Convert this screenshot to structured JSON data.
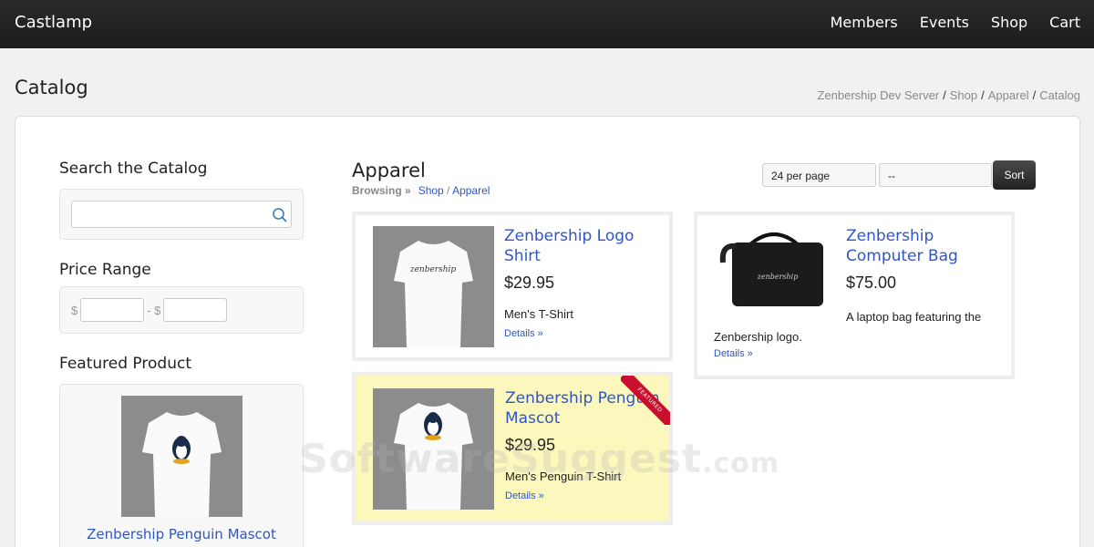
{
  "header": {
    "brand": "Castlamp",
    "nav": [
      "Members",
      "Events",
      "Shop",
      "Cart"
    ]
  },
  "page": {
    "title": "Catalog",
    "breadcrumb": [
      "Zenbership Dev Server",
      "Shop",
      "Apparel",
      "Catalog"
    ]
  },
  "sidebar": {
    "search_heading": "Search the Catalog",
    "search_value": "",
    "price_heading": "Price Range",
    "currency_symbol": "$",
    "price_separator": "- $",
    "featured_heading": "Featured Product",
    "featured_name": "Zenbership Penguin Mascot"
  },
  "catalog": {
    "title": "Apparel",
    "browsing_label": "Browsing »",
    "browsing_path": [
      "Shop",
      "Apparel"
    ],
    "per_page": "24 per page",
    "order": "--",
    "sort_label": "Sort"
  },
  "products": [
    {
      "name": "Zenbership Logo Shirt",
      "price": "$29.95",
      "desc": "Men's T-Shirt",
      "details": "Details »"
    },
    {
      "name": "Zenbership Computer Bag",
      "price": "$75.00",
      "desc": "A laptop bag featuring the Zenbership logo.",
      "details": "Details »"
    },
    {
      "name": "Zenbership Penguin Mascot",
      "price": "$29.95",
      "desc": "Men's Penguin T-Shirt",
      "details": "Details »",
      "ribbon": "FEATURED"
    }
  ],
  "watermark": {
    "main": "SoftwareSuggest",
    "suffix": ".com"
  },
  "colors": {
    "link": "#2f56c4",
    "featured_bg": "#fcf8bd",
    "topbar": "#222222",
    "ribbon": "#c8102e"
  }
}
